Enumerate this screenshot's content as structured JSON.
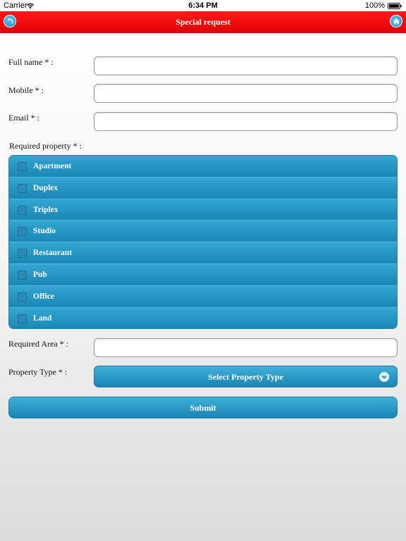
{
  "status_bar": {
    "carrier": "Carrier",
    "time": "6:34 PM",
    "battery": "100%"
  },
  "header": {
    "title": "Special request",
    "back_icon": "back-arrow-icon",
    "home_icon": "home-icon"
  },
  "form": {
    "full_name": {
      "label": "Full name * :",
      "value": "",
      "placeholder": ""
    },
    "mobile": {
      "label": "Mobile * :",
      "value": "",
      "placeholder": ""
    },
    "email": {
      "label": "Email * :",
      "value": "",
      "placeholder": ""
    },
    "required_property": {
      "label": "Required property * :",
      "options": [
        {
          "label": "Apartment",
          "checked": false
        },
        {
          "label": "Duplex",
          "checked": false
        },
        {
          "label": "Triplex",
          "checked": false
        },
        {
          "label": "Studio",
          "checked": false
        },
        {
          "label": "Restaurant",
          "checked": false
        },
        {
          "label": "Pub",
          "checked": false
        },
        {
          "label": "Office",
          "checked": false
        },
        {
          "label": "Land",
          "checked": false
        }
      ]
    },
    "required_area": {
      "label": "Required Area * :",
      "value": "",
      "placeholder": ""
    },
    "property_type": {
      "label": "Property Type * :",
      "selected": "Select Property Type"
    },
    "submit_label": "Submit"
  },
  "colors": {
    "header_red": "#e00000",
    "accent_blue": "#1a86b5"
  }
}
